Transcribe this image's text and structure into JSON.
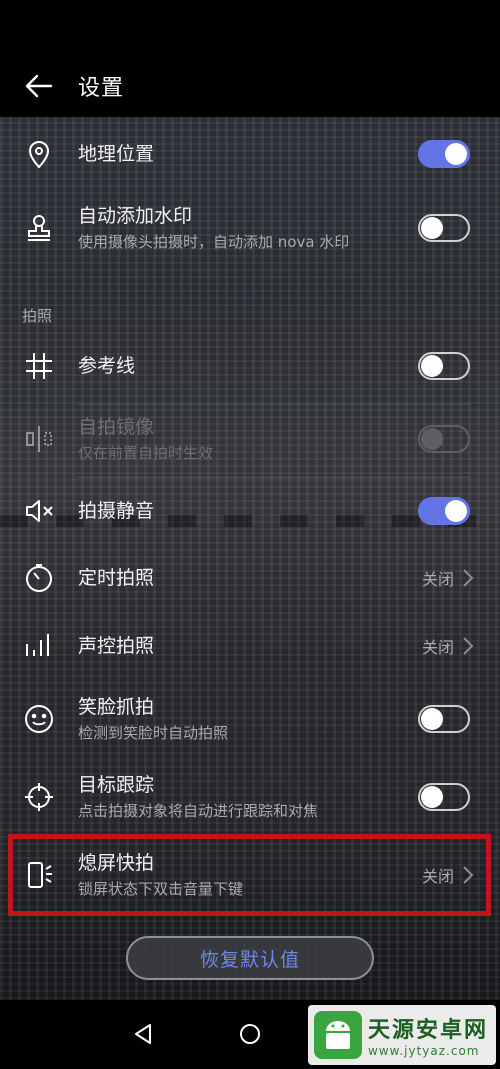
{
  "header": {
    "title": "设置"
  },
  "location": {
    "label": "地理位置",
    "toggle": "on"
  },
  "watermark_setting": {
    "label": "自动添加水印",
    "sub": "使用摄像头拍摄时，自动添加 nova 水印",
    "toggle": "off"
  },
  "section": {
    "photo": "拍照"
  },
  "grid": {
    "label": "参考线",
    "toggle": "off"
  },
  "selfie_mirror": {
    "label": "自拍镜像",
    "sub": "仅在前置自拍时生效",
    "toggle": "off",
    "state": "disabled"
  },
  "mute": {
    "label": "拍摄静音",
    "toggle": "on"
  },
  "timer": {
    "label": "定时拍照",
    "value": "关闭"
  },
  "voice": {
    "label": "声控拍照",
    "value": "关闭"
  },
  "smile": {
    "label": "笑脸抓拍",
    "sub": "检测到笑脸时自动拍照",
    "toggle": "off"
  },
  "tracking": {
    "label": "目标跟踪",
    "sub": "点击拍摄对象将自动进行跟踪和对焦",
    "toggle": "off"
  },
  "ultra_snapshot": {
    "label": "熄屏快拍",
    "sub": "锁屏状态下双击音量下键",
    "value": "关闭"
  },
  "restore": {
    "label": "恢复默认值"
  },
  "brand": {
    "name": "天源安卓网",
    "url": "www.jytyaz.com"
  },
  "colors": {
    "accent": "#6274e6",
    "highlight": "#c3141d",
    "restore_text": "#6e86ee"
  }
}
